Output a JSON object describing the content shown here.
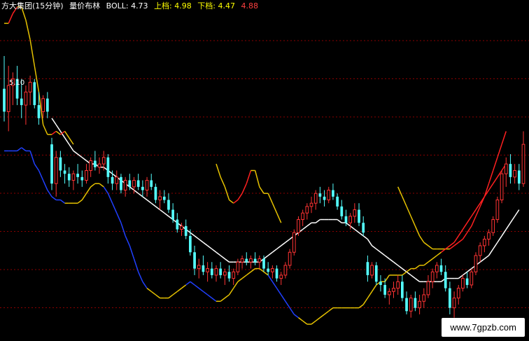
{
  "header": {
    "title": "方大集团(15分钟)",
    "indicator": "量价布林",
    "boll_label": "BOLL: 4.73",
    "upper_label": "上档: 4.98",
    "lower_label": "下档: 4.47",
    "extra_value": "4.88"
  },
  "price_label": "5.10",
  "watermark": "www.7gpzb.com",
  "colors": {
    "background": "#000000",
    "grid": "#8b0000",
    "up_candle": "#ff3333",
    "down_candle": "#54ffff",
    "mid_line": "#ffffff",
    "band_up": "#ff2020",
    "band_flat": "#e6c200",
    "band_down": "#2040ff",
    "title": "#ffffff",
    "indicator": "#ffffff",
    "boll": "#ffffff",
    "upper": "#ffff00",
    "lower": "#ffff00",
    "extra": "#ff4040"
  },
  "chart_data": {
    "type": "candlestick",
    "price_range": [
      4.3,
      5.3
    ],
    "grid": true,
    "candles": [
      [
        5.05,
        5.15,
        4.95,
        4.98
      ],
      [
        4.98,
        5.12,
        4.92,
        5.06
      ],
      [
        5.06,
        5.1,
        5.0,
        5.08
      ],
      [
        5.08,
        5.12,
        5.0,
        5.02
      ],
      [
        5.02,
        5.08,
        4.96,
        5.0
      ],
      [
        5.0,
        5.06,
        4.94,
        5.04
      ],
      [
        5.04,
        5.09,
        5.0,
        5.07
      ],
      [
        5.07,
        5.08,
        4.99,
        5.0
      ],
      [
        5.0,
        5.04,
        4.94,
        4.96
      ],
      [
        4.98,
        5.03,
        4.96,
        5.02
      ],
      [
        5.02,
        5.04,
        4.96,
        4.98
      ],
      [
        4.88,
        4.9,
        4.74,
        4.76
      ],
      [
        4.76,
        4.86,
        4.72,
        4.84
      ],
      [
        4.84,
        4.86,
        4.78,
        4.8
      ],
      [
        4.8,
        4.82,
        4.76,
        4.79
      ],
      [
        4.79,
        4.81,
        4.75,
        4.77
      ],
      [
        4.77,
        4.8,
        4.74,
        4.79
      ],
      [
        4.79,
        4.82,
        4.76,
        4.78
      ],
      [
        4.78,
        4.8,
        4.75,
        4.77
      ],
      [
        4.77,
        4.82,
        4.76,
        4.8
      ],
      [
        4.8,
        4.84,
        4.78,
        4.83
      ],
      [
        4.83,
        4.86,
        4.8,
        4.81
      ],
      [
        4.81,
        4.84,
        4.79,
        4.82
      ],
      [
        4.82,
        4.86,
        4.8,
        4.84
      ],
      [
        4.84,
        4.85,
        4.76,
        4.78
      ],
      [
        4.78,
        4.8,
        4.74,
        4.76
      ],
      [
        4.76,
        4.8,
        4.74,
        4.78
      ],
      [
        4.78,
        4.79,
        4.73,
        4.74
      ],
      [
        4.74,
        4.78,
        4.72,
        4.77
      ],
      [
        4.77,
        4.79,
        4.74,
        4.75
      ],
      [
        4.75,
        4.78,
        4.73,
        4.77
      ],
      [
        4.77,
        4.79,
        4.74,
        4.75
      ],
      [
        4.75,
        4.77,
        4.72,
        4.74
      ],
      [
        4.74,
        4.78,
        4.72,
        4.77
      ],
      [
        4.77,
        4.79,
        4.74,
        4.75
      ],
      [
        4.75,
        4.76,
        4.7,
        4.71
      ],
      [
        4.71,
        4.74,
        4.68,
        4.72
      ],
      [
        4.72,
        4.74,
        4.7,
        4.71
      ],
      [
        4.71,
        4.73,
        4.67,
        4.68
      ],
      [
        4.68,
        4.7,
        4.64,
        4.65
      ],
      [
        4.65,
        4.67,
        4.61,
        4.62
      ],
      [
        4.62,
        4.64,
        4.6,
        4.63
      ],
      [
        4.63,
        4.65,
        4.59,
        4.6
      ],
      [
        4.6,
        4.62,
        4.54,
        4.55
      ],
      [
        4.55,
        4.57,
        4.48,
        4.5
      ],
      [
        4.5,
        4.53,
        4.47,
        4.51
      ],
      [
        4.51,
        4.54,
        4.48,
        4.49
      ],
      [
        4.49,
        4.52,
        4.46,
        4.5
      ],
      [
        4.5,
        4.52,
        4.47,
        4.48
      ],
      [
        4.48,
        4.51,
        4.46,
        4.5
      ],
      [
        4.5,
        4.52,
        4.47,
        4.48
      ],
      [
        4.48,
        4.5,
        4.45,
        4.49
      ],
      [
        4.49,
        4.51,
        4.46,
        4.47
      ],
      [
        4.47,
        4.5,
        4.45,
        4.49
      ],
      [
        4.49,
        4.53,
        4.48,
        4.52
      ],
      [
        4.52,
        4.54,
        4.5,
        4.53
      ],
      [
        4.53,
        4.55,
        4.51,
        4.52
      ],
      [
        4.52,
        4.54,
        4.5,
        4.53
      ],
      [
        4.53,
        4.55,
        4.51,
        4.52
      ],
      [
        4.52,
        4.54,
        4.5,
        4.53
      ],
      [
        4.53,
        4.54,
        4.49,
        4.5
      ],
      [
        4.5,
        4.52,
        4.48,
        4.49
      ],
      [
        4.49,
        4.51,
        4.47,
        4.5
      ],
      [
        4.5,
        4.51,
        4.46,
        4.47
      ],
      [
        4.47,
        4.49,
        4.45,
        4.48
      ],
      [
        4.48,
        4.52,
        4.47,
        4.51
      ],
      [
        4.51,
        4.56,
        4.5,
        4.55
      ],
      [
        4.55,
        4.62,
        4.54,
        4.61
      ],
      [
        4.61,
        4.66,
        4.6,
        4.65
      ],
      [
        4.65,
        4.68,
        4.63,
        4.67
      ],
      [
        4.67,
        4.7,
        4.65,
        4.69
      ],
      [
        4.69,
        4.72,
        4.67,
        4.7
      ],
      [
        4.7,
        4.74,
        4.68,
        4.73
      ],
      [
        4.73,
        4.75,
        4.7,
        4.72
      ],
      [
        4.72,
        4.74,
        4.69,
        4.71
      ],
      [
        4.71,
        4.75,
        4.7,
        4.74
      ],
      [
        4.74,
        4.76,
        4.71,
        4.72
      ],
      [
        4.72,
        4.73,
        4.68,
        4.69
      ],
      [
        4.69,
        4.71,
        4.65,
        4.66
      ],
      [
        4.66,
        4.68,
        4.63,
        4.64
      ],
      [
        4.64,
        4.67,
        4.62,
        4.66
      ],
      [
        4.66,
        4.7,
        4.64,
        4.68
      ],
      [
        4.68,
        4.7,
        4.63,
        4.64
      ],
      [
        4.64,
        4.66,
        4.6,
        4.61
      ],
      [
        4.52,
        4.54,
        4.46,
        4.48
      ],
      [
        4.48,
        4.52,
        4.47,
        4.51
      ],
      [
        4.51,
        4.52,
        4.45,
        4.46
      ],
      [
        4.46,
        4.48,
        4.43,
        4.45
      ],
      [
        4.45,
        4.47,
        4.41,
        4.42
      ],
      [
        4.42,
        4.44,
        4.39,
        4.43
      ],
      [
        4.43,
        4.46,
        4.41,
        4.44
      ],
      [
        4.44,
        4.48,
        4.42,
        4.46
      ],
      [
        4.46,
        4.48,
        4.4,
        4.41
      ],
      [
        4.41,
        4.43,
        4.36,
        4.37
      ],
      [
        4.37,
        4.42,
        4.35,
        4.41
      ],
      [
        4.41,
        4.43,
        4.37,
        4.38
      ],
      [
        4.38,
        4.42,
        4.36,
        4.4
      ],
      [
        4.4,
        4.44,
        4.38,
        4.42
      ],
      [
        4.42,
        4.48,
        4.41,
        4.46
      ],
      [
        4.46,
        4.5,
        4.44,
        4.49
      ],
      [
        4.49,
        4.52,
        4.47,
        4.51
      ],
      [
        4.51,
        4.53,
        4.48,
        4.49
      ],
      [
        4.49,
        4.51,
        4.43,
        4.44
      ],
      [
        4.44,
        4.46,
        4.36,
        4.38
      ],
      [
        4.38,
        4.43,
        4.35,
        4.41
      ],
      [
        4.41,
        4.45,
        4.39,
        4.44
      ],
      [
        4.44,
        4.48,
        4.43,
        4.47
      ],
      [
        4.47,
        4.49,
        4.44,
        4.45
      ],
      [
        4.45,
        4.5,
        4.44,
        4.49
      ],
      [
        4.49,
        4.55,
        4.48,
        4.54
      ],
      [
        4.54,
        4.58,
        4.52,
        4.57
      ],
      [
        4.57,
        4.6,
        4.55,
        4.59
      ],
      [
        4.59,
        4.62,
        4.57,
        4.61
      ],
      [
        4.61,
        4.66,
        4.6,
        4.65
      ],
      [
        4.65,
        4.72,
        4.64,
        4.71
      ],
      [
        4.71,
        4.8,
        4.7,
        4.79
      ],
      [
        4.79,
        4.84,
        4.75,
        4.82
      ],
      [
        4.82,
        4.85,
        4.76,
        4.78
      ],
      [
        4.78,
        4.82,
        4.76,
        4.8
      ],
      [
        4.8,
        4.82,
        4.74,
        4.76
      ],
      [
        4.76,
        4.92,
        4.75,
        4.88
      ]
    ],
    "mid": [
      null,
      null,
      null,
      null,
      null,
      null,
      null,
      null,
      null,
      null,
      null,
      4.96,
      4.94,
      4.92,
      4.9,
      4.88,
      4.86,
      4.85,
      4.84,
      4.83,
      4.82,
      4.82,
      4.81,
      4.81,
      4.8,
      4.79,
      4.78,
      4.77,
      4.76,
      4.75,
      4.74,
      4.73,
      4.72,
      4.71,
      4.7,
      4.69,
      4.68,
      4.67,
      4.66,
      4.65,
      4.64,
      4.63,
      4.62,
      4.61,
      4.6,
      4.59,
      4.58,
      4.57,
      4.56,
      4.55,
      4.54,
      4.53,
      4.52,
      4.52,
      4.52,
      4.52,
      4.52,
      4.52,
      4.52,
      4.52,
      4.53,
      4.54,
      4.55,
      4.56,
      4.57,
      4.58,
      4.59,
      4.6,
      4.61,
      4.62,
      4.63,
      4.64,
      4.64,
      4.65,
      4.65,
      4.65,
      4.65,
      4.65,
      4.64,
      4.64,
      4.63,
      4.62,
      4.61,
      4.6,
      4.59,
      4.57,
      4.56,
      4.55,
      4.54,
      4.53,
      4.52,
      4.51,
      4.5,
      4.49,
      4.48,
      4.47,
      4.46,
      4.46,
      4.46,
      4.46,
      4.46,
      4.46,
      4.47,
      4.47,
      4.47,
      4.47,
      4.48,
      4.49,
      4.5,
      4.51,
      4.52,
      4.53,
      4.54,
      4.56,
      4.58,
      4.6,
      4.62,
      4.64,
      4.66,
      4.68
    ],
    "band_top": [
      5.25,
      5.25,
      5.28,
      5.3,
      5.3,
      5.26,
      5.2,
      5.12,
      5.04,
      4.94,
      4.91,
      4.91,
      4.92,
      4.91,
      4.92,
      4.9,
      4.88,
      null,
      null,
      null,
      null,
      null,
      null,
      null,
      null,
      null,
      null,
      null,
      null,
      null,
      null,
      null,
      null,
      null,
      null,
      null,
      null,
      null,
      null,
      null,
      null,
      null,
      null,
      null,
      null,
      null,
      null,
      null,
      null,
      4.82,
      4.78,
      4.75,
      4.71,
      4.7,
      4.71,
      4.73,
      4.76,
      4.8,
      4.8,
      4.75,
      4.73,
      4.73,
      4.7,
      4.67,
      4.64,
      null,
      null,
      null,
      null,
      null,
      null,
      null,
      null,
      null,
      null,
      null,
      null,
      null,
      null,
      null,
      null,
      null,
      null,
      null,
      null,
      null,
      null,
      null,
      null,
      null,
      null,
      4.75,
      4.72,
      4.69,
      4.66,
      4.63,
      4.6,
      4.58,
      4.57,
      4.56,
      4.56,
      4.56,
      4.56,
      4.56,
      4.57,
      4.58,
      4.59,
      4.61,
      4.63,
      4.66,
      4.69,
      4.72,
      4.76,
      4.8,
      4.84,
      4.88,
      4.92
    ],
    "band_bottom": [
      4.86,
      4.86,
      4.86,
      4.86,
      4.87,
      4.86,
      4.86,
      4.82,
      4.8,
      4.77,
      4.74,
      4.72,
      4.71,
      4.71,
      4.7,
      4.7,
      4.7,
      4.7,
      4.71,
      4.73,
      4.75,
      4.76,
      4.76,
      4.75,
      4.73,
      4.7,
      4.67,
      4.64,
      4.6,
      4.57,
      4.53,
      4.49,
      4.46,
      4.44,
      4.43,
      4.42,
      4.41,
      4.41,
      4.41,
      4.42,
      4.43,
      4.44,
      4.45,
      4.46,
      4.45,
      4.44,
      4.43,
      4.42,
      4.41,
      4.4,
      4.4,
      4.41,
      4.42,
      4.44,
      4.46,
      4.47,
      4.48,
      4.49,
      4.5,
      4.5,
      4.49,
      4.48,
      4.46,
      4.44,
      4.42,
      4.4,
      4.38,
      4.36,
      4.35,
      4.34,
      4.33,
      4.33,
      4.34,
      4.35,
      4.36,
      4.37,
      4.38,
      4.38,
      4.38,
      4.38,
      4.38,
      4.38,
      4.38,
      4.39,
      4.41,
      4.43,
      4.45,
      4.46,
      4.46,
      4.48,
      4.48,
      4.48,
      4.48,
      4.49,
      4.5,
      4.5,
      4.51,
      4.51,
      4.52,
      4.53,
      4.54,
      4.55,
      4.56,
      4.57,
      4.58,
      4.6,
      4.62,
      4.64,
      4.66,
      4.68,
      4.7,
      4.72,
      4.74,
      4.76,
      4.78,
      4.8,
      4.82
    ],
    "band_bottom_colors": [
      "#2040ff",
      "#2040ff",
      "#2040ff",
      "#2040ff",
      "#2040ff",
      "#2040ff",
      "#2040ff",
      "#2040ff",
      "#2040ff",
      "#2040ff",
      "#2040ff",
      "#2040ff",
      "#2040ff",
      "#2040ff",
      "#2040ff",
      "#e6c200",
      "#e6c200",
      "#e6c200",
      "#e6c200",
      "#e6c200",
      "#e6c200",
      "#e6c200",
      "#e6c200",
      "#e6c200",
      "#2040ff",
      "#2040ff",
      "#2040ff",
      "#2040ff",
      "#2040ff",
      "#2040ff",
      "#2040ff",
      "#2040ff",
      "#2040ff",
      "#2040ff",
      "#e6c200",
      "#e6c200",
      "#e6c200",
      "#e6c200",
      "#e6c200",
      "#e6c200",
      "#e6c200",
      "#e6c200",
      "#e6c200",
      "#2040ff",
      "#2040ff",
      "#2040ff",
      "#2040ff",
      "#2040ff",
      "#2040ff",
      "#2040ff",
      "#e6c200",
      "#e6c200",
      "#e6c200",
      "#e6c200",
      "#e6c200",
      "#e6c200",
      "#e6c200",
      "#e6c200",
      "#e6c200",
      "#e6c200",
      "#e6c200",
      "#e6c200",
      "#2040ff",
      "#2040ff",
      "#2040ff",
      "#2040ff",
      "#2040ff",
      "#2040ff",
      "#2040ff",
      "#e6c200",
      "#e6c200",
      "#e6c200",
      "#e6c200",
      "#e6c200",
      "#e6c200",
      "#e6c200",
      "#e6c200",
      "#e6c200",
      "#e6c200",
      "#e6c200",
      "#e6c200",
      "#e6c200",
      "#e6c200",
      "#e6c200",
      "#e6c200",
      "#e6c200",
      "#e6c200",
      "#e6c200",
      "#e6c200",
      "#e6c200",
      "#e6c200",
      "#e6c200",
      "#e6c200",
      "#e6c200",
      "#e6c200",
      "#e6c200",
      "#e6c200",
      "#e6c200",
      "#e6c200",
      "#e6c200",
      "#e6c200",
      "#e6c200",
      "#ff2020",
      "#ff2020",
      "#ff2020",
      "#ff2020",
      "#ff2020",
      "#ff2020",
      "#ff2020",
      "#ff2020",
      "#ff2020",
      "#ff2020",
      "#ff2020",
      "#ff2020",
      "#ff2020",
      "#ff2020",
      "#ff2020"
    ]
  }
}
